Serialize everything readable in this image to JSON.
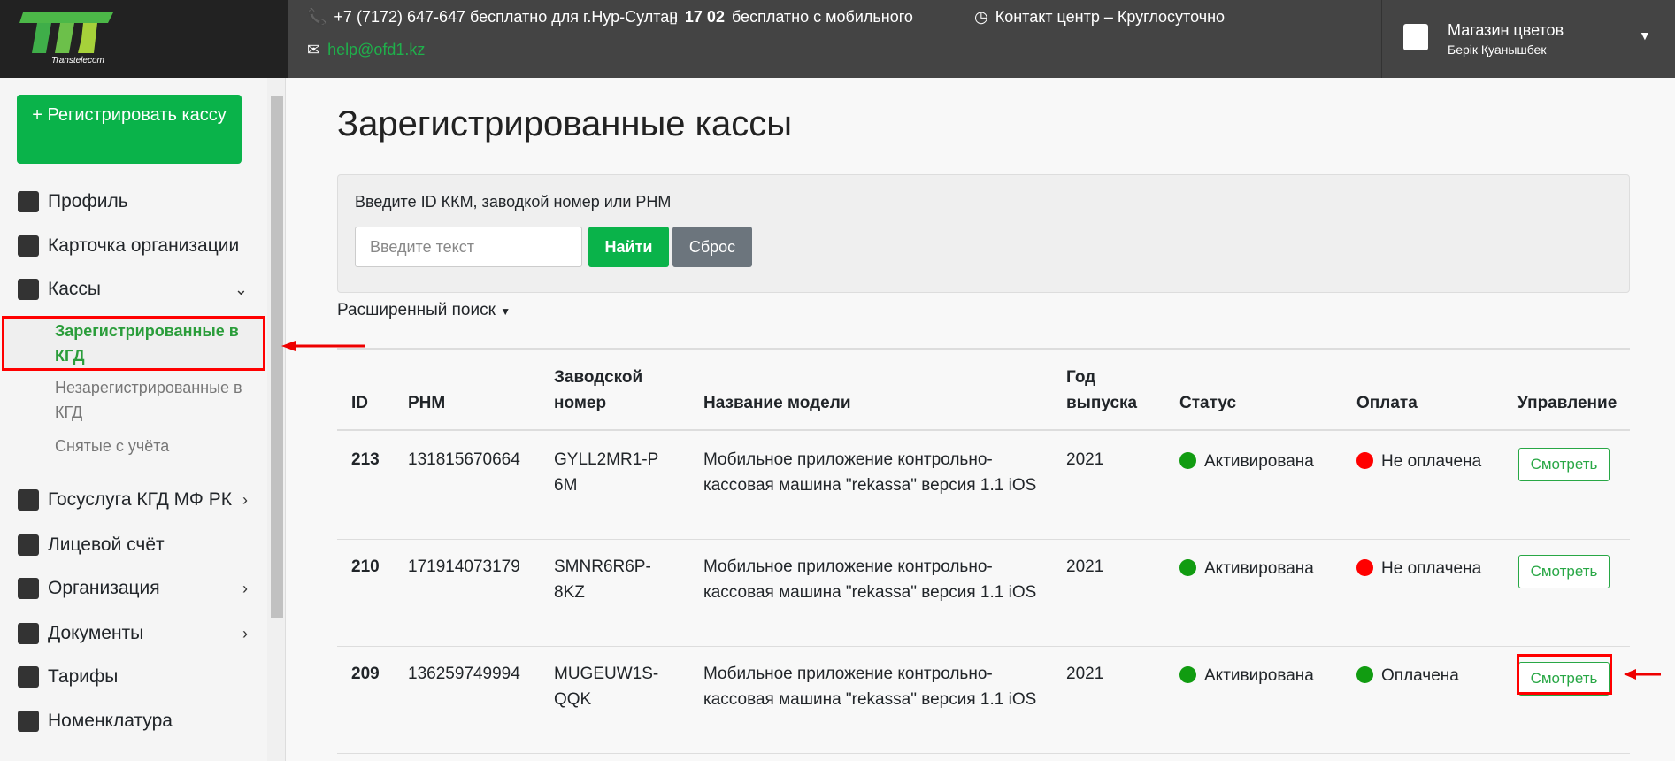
{
  "header": {
    "logo_text": "Transtelecom",
    "phone": "+7 (7172) 647-647 бесплатно для г.Нур-Султан",
    "mobile": "17 02",
    "mobile_text": "бесплатно с мобильного",
    "contact": "Контакт центр – Круглосуточно",
    "email": "help@ofd1.kz",
    "user_org": "Магазин цветов",
    "user_name": "Берік Қуанышбек"
  },
  "sidebar": {
    "register": "+ Регистрировать кассу",
    "items": [
      {
        "label": "Профиль"
      },
      {
        "label": "Карточка организации"
      },
      {
        "label": "Кассы"
      },
      {
        "label": "Госуслуга КГД МФ РК"
      },
      {
        "label": "Лицевой счёт"
      },
      {
        "label": "Организация"
      },
      {
        "label": "Документы"
      },
      {
        "label": "Тарифы"
      },
      {
        "label": "Номенклатура"
      }
    ],
    "sub": [
      "Зарегистрированные в КГД",
      "Незарегистрированные в КГД",
      "Снятые с учёта"
    ]
  },
  "main": {
    "title": "Зарегистрированные кассы",
    "search_label": "Введите ID ККМ, заводкой номер или РНМ",
    "search_placeholder": "Введите текст",
    "find": "Найти",
    "reset": "Сброс",
    "advanced": "Расширенный поиск",
    "columns": [
      "ID",
      "РНМ",
      "Заводской номер",
      "Название модели",
      "Год выпуска",
      "Статус",
      "Оплата",
      "Управление"
    ],
    "rows": [
      {
        "id": "213",
        "rnm": "131815670664",
        "serial": "GYLL2MR1-P6M",
        "model": "Мобильное приложение контрольно-кассовая машина \"rekassa\" версия 1.1 iOS",
        "year": "2021",
        "status": "Активирована",
        "payment": "Не оплачена",
        "action": "Смотреть"
      },
      {
        "id": "210",
        "rnm": "171914073179",
        "serial": "SMNR6R6P-8KZ",
        "model": "Мобильное приложение контрольно-кассовая машина \"rekassa\" версия 1.1 iOS",
        "year": "2021",
        "status": "Активирована",
        "payment": "Не оплачена",
        "action": "Смотреть"
      },
      {
        "id": "209",
        "rnm": "136259749994",
        "serial": "MUGEUW1S-QQK",
        "model": "Мобильное приложение контрольно-кассовая машина \"rekassa\" версия 1.1 iOS",
        "year": "2021",
        "status": "Активирована",
        "payment": "Оплачена",
        "action": "Смотреть"
      }
    ]
  },
  "colors": {
    "green": "#0ab34a",
    "red": "#ff0000",
    "status_green": "#119c11"
  }
}
